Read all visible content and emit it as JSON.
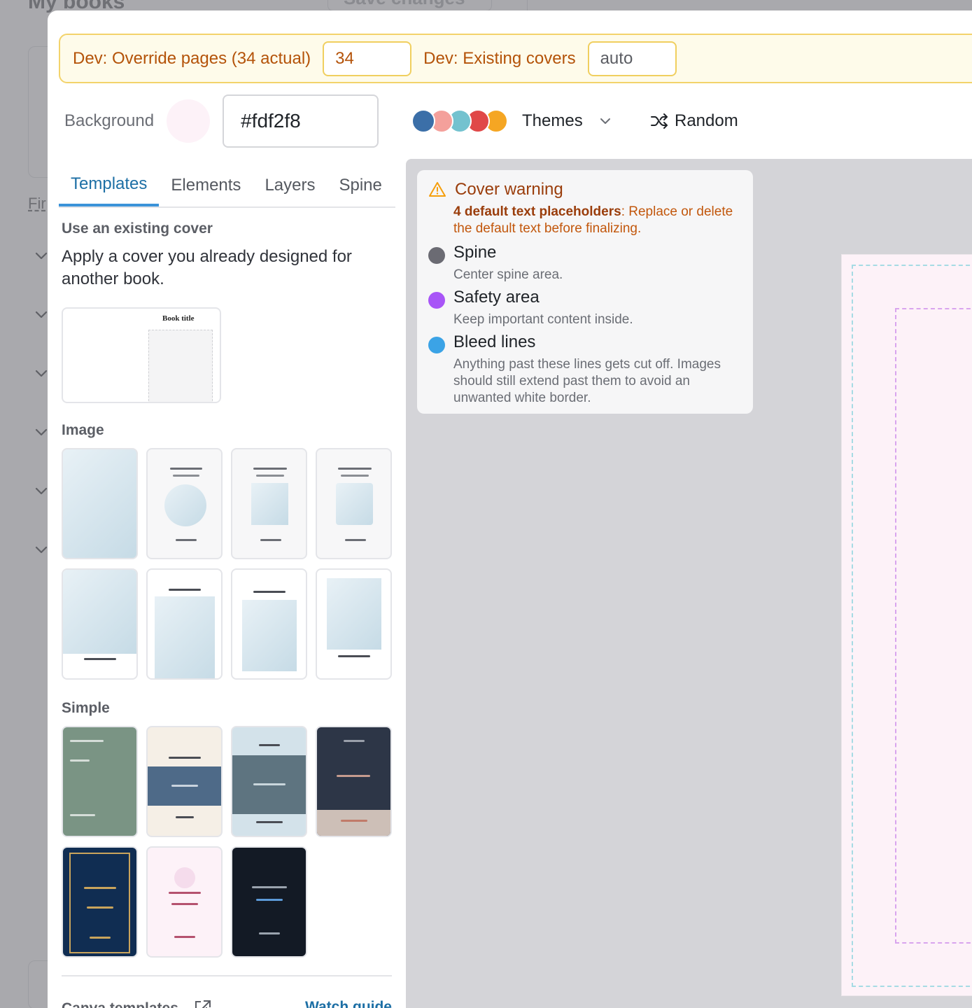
{
  "background_page": {
    "title": "My books",
    "save_label": "Save changes",
    "link_label": "Fir"
  },
  "dev": {
    "override_label": "Dev: Override pages (34 actual)",
    "override_value": "34",
    "covers_label": "Dev: Existing covers",
    "covers_value": "auto"
  },
  "background": {
    "label": "Background",
    "color": "#fdf2f8",
    "hex_value": "#fdf2f8"
  },
  "themes": {
    "label": "Themes",
    "dot_colors": [
      "#3b6fa8",
      "#f4a09b",
      "#73c2cf",
      "#e04848",
      "#f5a623"
    ]
  },
  "random_label": "Random",
  "tabs": [
    {
      "label": "Templates",
      "active": true
    },
    {
      "label": "Elements",
      "active": false
    },
    {
      "label": "Layers",
      "active": false
    },
    {
      "label": "Spine",
      "active": false
    }
  ],
  "existing": {
    "title": "Use an existing cover",
    "description": "Apply a cover you already designed for another book.",
    "card_title": "Book title"
  },
  "image_section": {
    "title": "Image"
  },
  "simple_section": {
    "title": "Simple"
  },
  "canva": {
    "title": "Canva templates",
    "watch_label": "Watch guide"
  },
  "warning": {
    "title": "Cover warning",
    "bold": "4 default text placeholders",
    "text": ": Replace or delete the default text before finalizing."
  },
  "legend": [
    {
      "title": "Spine",
      "subtitle": "Center spine area.",
      "color": "#6b6b73"
    },
    {
      "title": "Safety area",
      "subtitle": "Keep important content inside.",
      "color": "#a855f7"
    },
    {
      "title": "Bleed lines",
      "subtitle": "Anything past these lines gets cut off. Images should still extend past them to avoid an unwanted white border.",
      "color": "#3ba3e6"
    }
  ]
}
